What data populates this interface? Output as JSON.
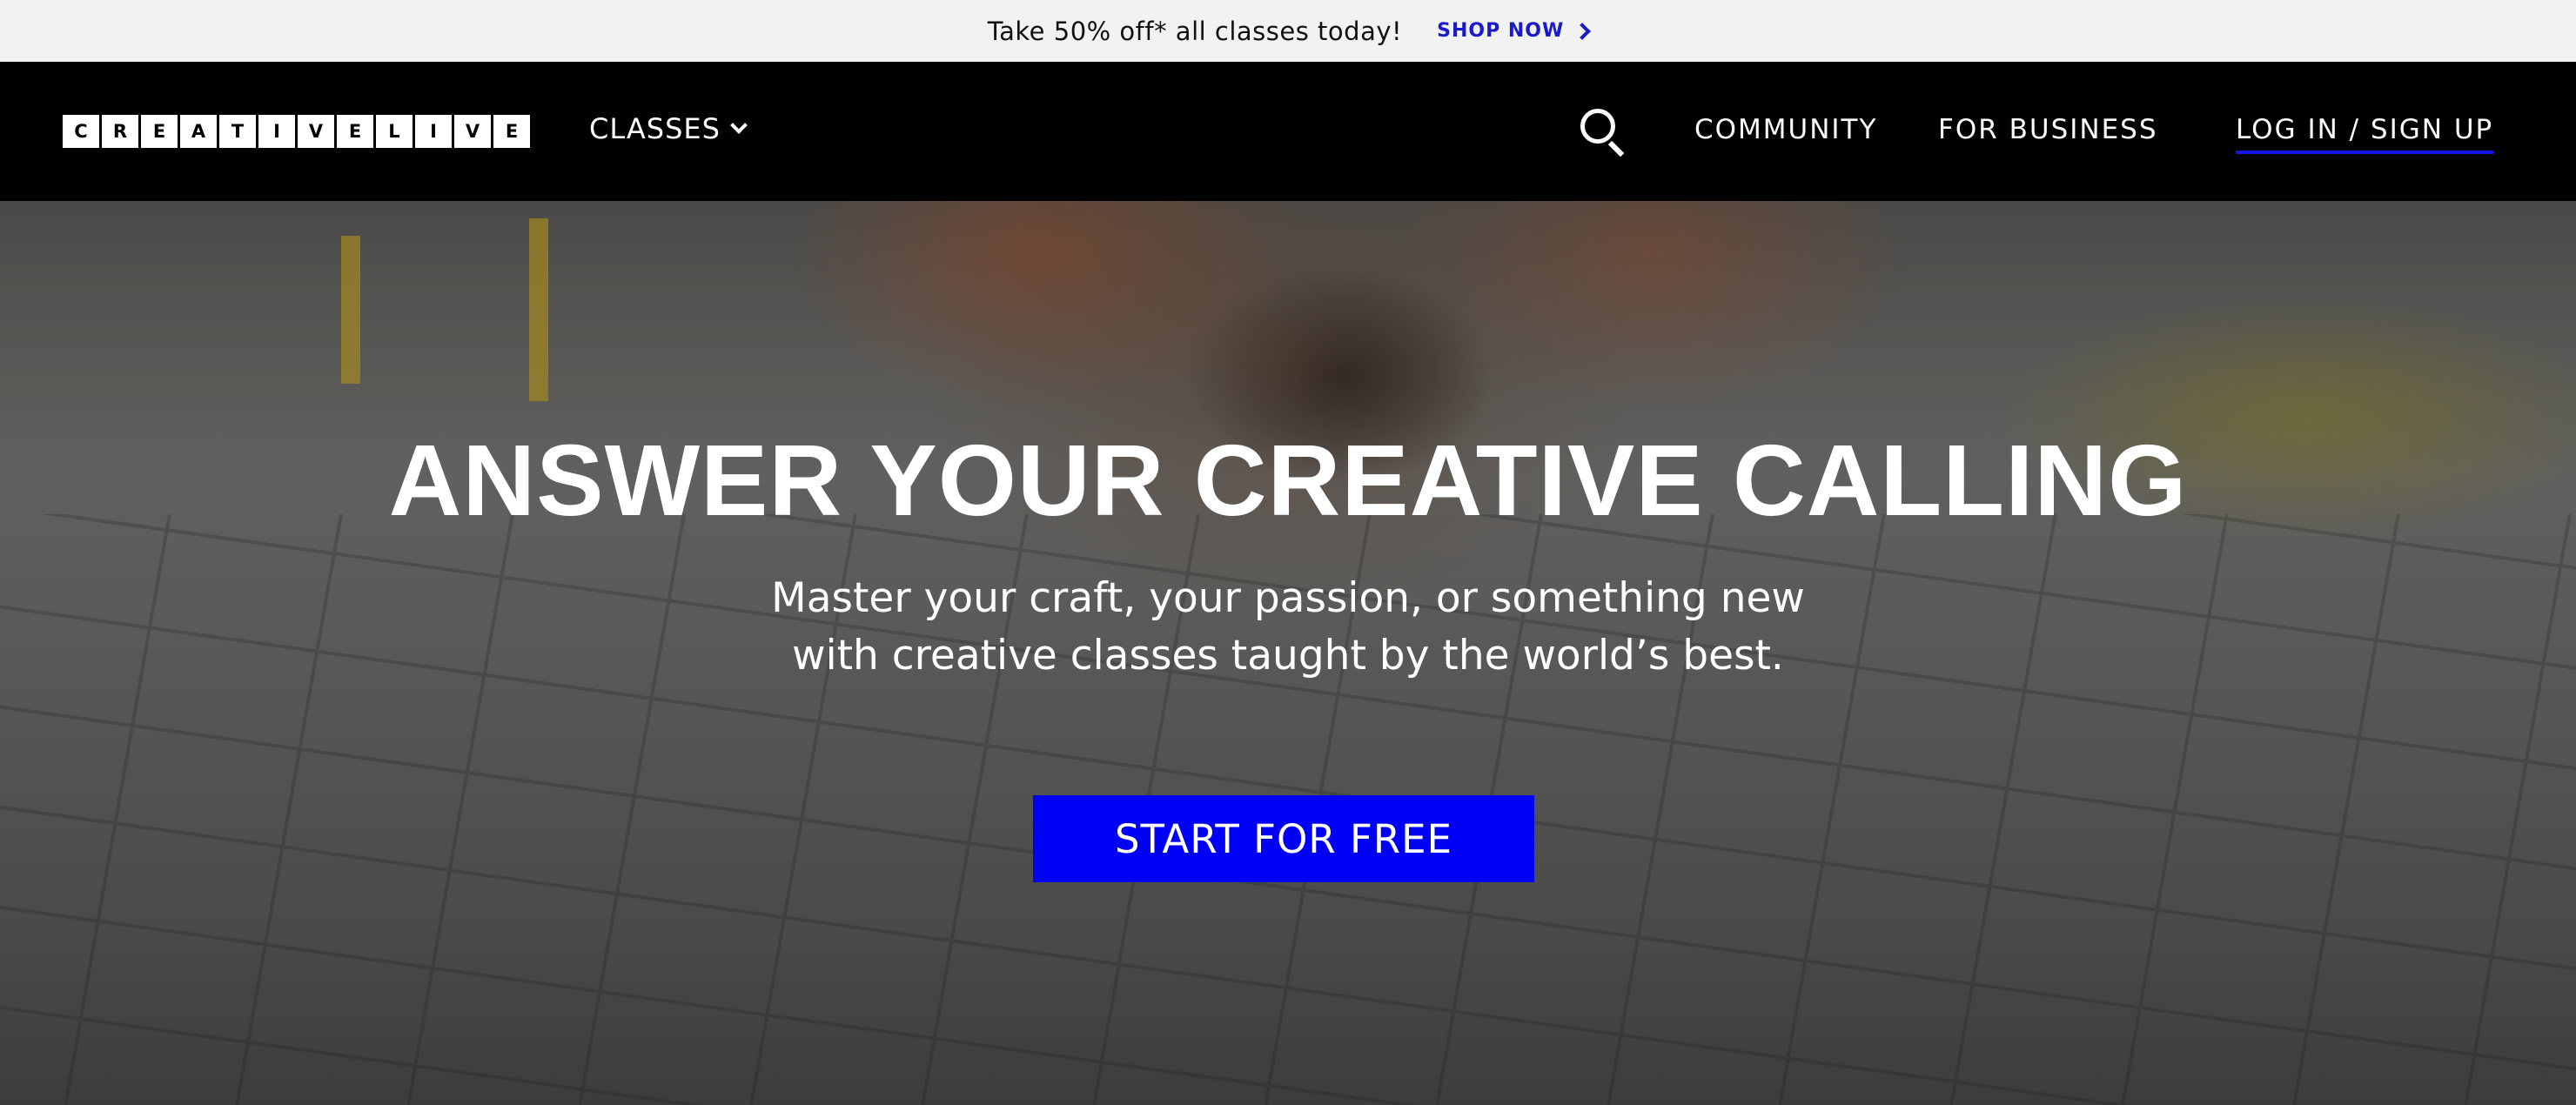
{
  "promo": {
    "text": "Take 50% off* all classes today!",
    "link_label": "SHOP NOW"
  },
  "nav": {
    "logo_letters": [
      "C",
      "R",
      "E",
      "A",
      "T",
      "I",
      "V",
      "E",
      "L",
      "I",
      "V",
      "E"
    ],
    "classes_label": "CLASSES",
    "community_label": "COMMUNITY",
    "business_label": "FOR BUSINESS",
    "login_label": "LOG IN / SIGN UP"
  },
  "hero": {
    "title": "ANSWER YOUR CREATIVE CALLING",
    "subtitle_line1": "Master your craft, your passion, or something new",
    "subtitle_line2": "with creative classes taught by the world’s best.",
    "cta_label": "START FOR FREE"
  },
  "colors": {
    "accent": "#0000f5",
    "promo_link": "#1a1acc",
    "promo_bg": "#f2f2f2",
    "nav_bg": "#000000"
  },
  "icons": [
    "chevron-right-icon",
    "chevron-down-icon",
    "search-icon"
  ]
}
